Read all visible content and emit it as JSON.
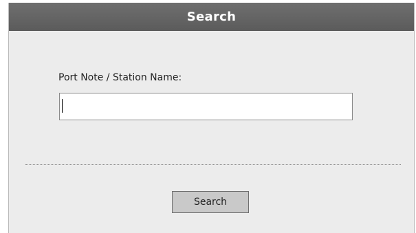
{
  "dialog": {
    "title": "Search",
    "field_label": "Port Note / Station Name:",
    "input_value": "",
    "search_button_label": "Search"
  },
  "colors": {
    "titlebar": "#5f5f5f",
    "panel": "#ececec",
    "button": "#c9c9c9"
  }
}
